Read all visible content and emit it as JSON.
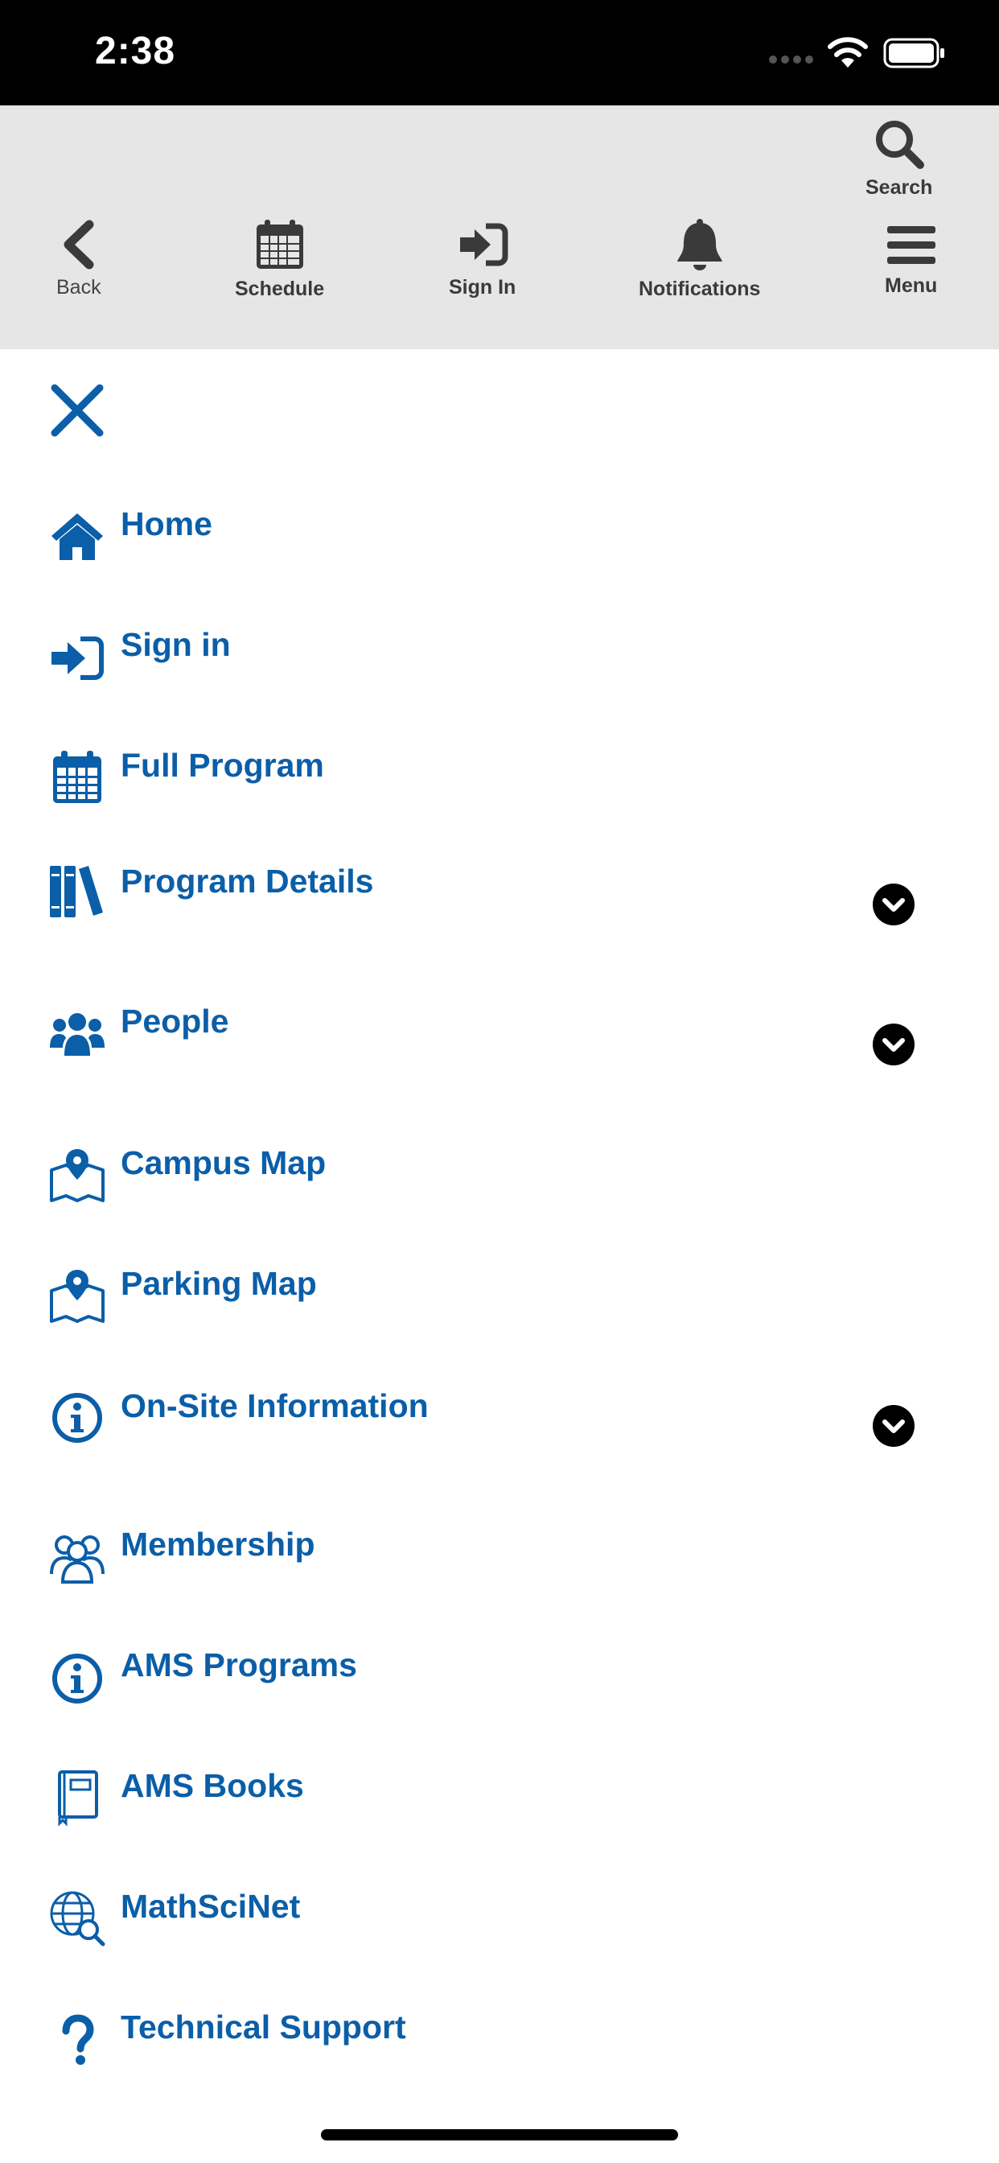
{
  "status_bar": {
    "time": "2:38"
  },
  "toolbar": {
    "search_label": "Search",
    "back_label": "Back",
    "schedule_label": "Schedule",
    "signin_label": "Sign In",
    "notifications_label": "Notifications",
    "menu_label": "Menu"
  },
  "menu": {
    "items": [
      {
        "label": "Home",
        "icon": "home-icon"
      },
      {
        "label": "Sign in",
        "icon": "sign-in-icon"
      },
      {
        "label": "Full Program",
        "icon": "calendar-icon"
      },
      {
        "label": "Program Details",
        "icon": "books-icon",
        "expandable": true
      },
      {
        "label": "People",
        "icon": "people-icon",
        "expandable": true
      },
      {
        "label": "Campus Map",
        "icon": "map-pin-icon"
      },
      {
        "label": "Parking Map",
        "icon": "map-pin-icon"
      },
      {
        "label": "On-Site Information",
        "icon": "info-icon",
        "expandable": true
      },
      {
        "label": "Membership",
        "icon": "membership-icon"
      },
      {
        "label": "AMS Programs",
        "icon": "info-icon"
      },
      {
        "label": "AMS Books",
        "icon": "book-icon"
      },
      {
        "label": "MathSciNet",
        "icon": "globe-search-icon"
      },
      {
        "label": "Technical Support",
        "icon": "question-icon"
      }
    ]
  },
  "colors": {
    "accent": "#0b5ea8",
    "toolbar_bg": "#e6e6e6",
    "toolbar_icon": "#3a3a3a"
  }
}
